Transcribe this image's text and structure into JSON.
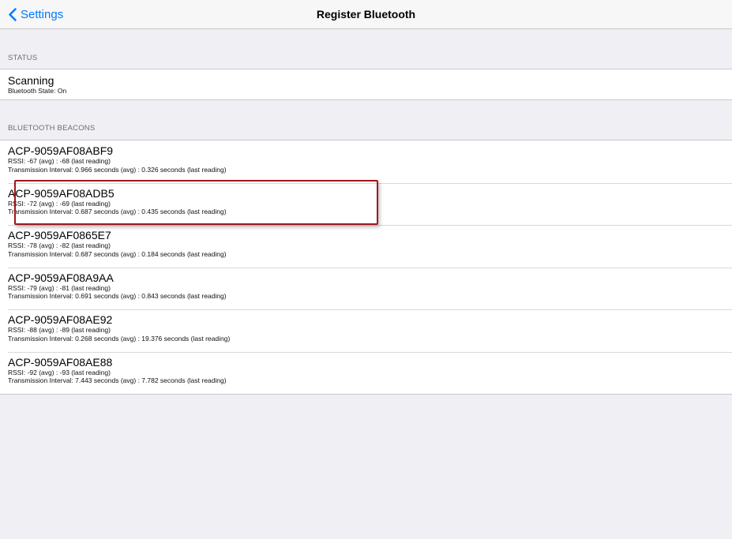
{
  "nav": {
    "back_label": "Settings",
    "title": "Register Bluetooth"
  },
  "status": {
    "header": "STATUS",
    "title": "Scanning",
    "subtitle": "Bluetooth State: On"
  },
  "beacons": {
    "header": "BLUETOOTH BEACONS",
    "items": [
      {
        "name": "ACP-9059AF08ABF9",
        "rssi": "RSSI: -67 (avg) : -68 (last reading)",
        "interval": "Transmission Interval: 0.966 seconds (avg) : 0.326 seconds (last reading)"
      },
      {
        "name": "ACP-9059AF08ADB5",
        "rssi": "RSSI: -72 (avg) : -69 (last reading)",
        "interval": "Transmission Interval: 0.687 seconds (avg) : 0.435 seconds (last reading)"
      },
      {
        "name": "ACP-9059AF0865E7",
        "rssi": "RSSI: -78 (avg) : -82 (last reading)",
        "interval": "Transmission Interval: 0.687 seconds (avg) : 0.184 seconds (last reading)"
      },
      {
        "name": "ACP-9059AF08A9AA",
        "rssi": "RSSI: -79 (avg) : -81 (last reading)",
        "interval": "Transmission Interval: 0.691 seconds (avg) : 0.843 seconds (last reading)"
      },
      {
        "name": "ACP-9059AF08AE92",
        "rssi": "RSSI: -88 (avg) : -89 (last reading)",
        "interval": "Transmission Interval: 0.268 seconds (avg) : 19.376 seconds (last reading)"
      },
      {
        "name": "ACP-9059AF08AE88",
        "rssi": "RSSI: -92 (avg) : -93 (last reading)",
        "interval": "Transmission Interval: 7.443 seconds (avg) : 7.782 seconds (last reading)"
      }
    ]
  },
  "colors": {
    "tint": "#007aff",
    "background": "#efeff4",
    "highlight": "#a3171f"
  }
}
